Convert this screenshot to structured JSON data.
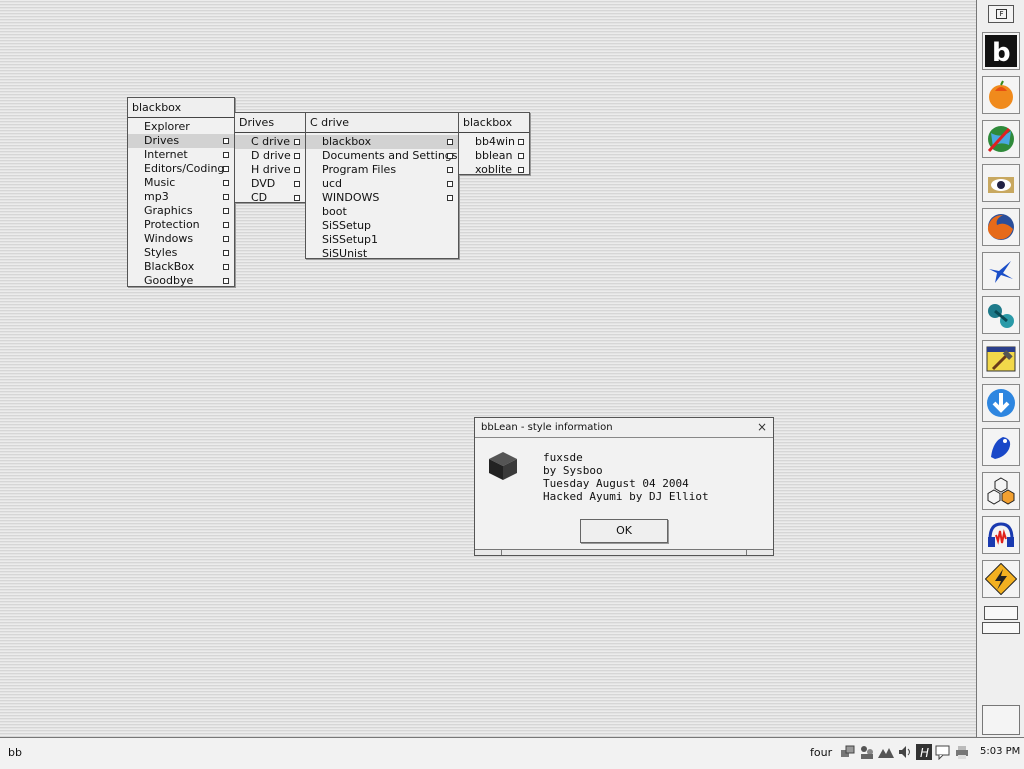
{
  "menus": {
    "root": {
      "title": "blackbox",
      "items": [
        "Explorer",
        "Drives",
        "Internet",
        "Editors/Coding",
        "Music",
        "mp3",
        "Graphics",
        "Protection",
        "Windows",
        "Styles",
        "BlackBox",
        "Goodbye"
      ]
    },
    "drives": {
      "title": "Drives",
      "items": [
        "C drive",
        "D drive",
        "H drive",
        "DVD",
        "CD"
      ]
    },
    "cdrive": {
      "title": "C drive",
      "items": [
        "blackbox",
        "Documents and Settings",
        "Program Files",
        "ucd",
        "WINDOWS",
        "boot",
        "SiSSetup",
        "SiSSetup1",
        "SiSUnist"
      ]
    },
    "blackbox_folder": {
      "title": "blackbox",
      "items": [
        "bb4win",
        "bblean",
        "xoblite"
      ]
    }
  },
  "dialog": {
    "title": "bbLean - style information",
    "lines": [
      "fuxsde",
      "by Sysboo",
      "Tuesday August 04 2004",
      "Hacked Ayumi by DJ Elliot"
    ],
    "ok_label": "OK",
    "close_glyph": "×"
  },
  "slit": {
    "top_button_label": "F",
    "icons": [
      "blackbox-icon",
      "mango-fruit-icon",
      "globe-arrow-icon",
      "eye-folder-icon",
      "firefox-icon",
      "bird-icon",
      "molecule-icon",
      "hammer-window-icon",
      "download-arrow-icon",
      "frog-icon",
      "hexagon-icon",
      "headphones-audio-icon",
      "lightning-tile-icon"
    ]
  },
  "taskbar": {
    "label": "bb",
    "workspace": "four",
    "clock": "5:03 PM",
    "tray_icons": [
      "network-icon",
      "people-icon",
      "mountains-icon",
      "speaker-icon",
      "h-app-icon",
      "chat-icon",
      "printer-icon"
    ]
  }
}
